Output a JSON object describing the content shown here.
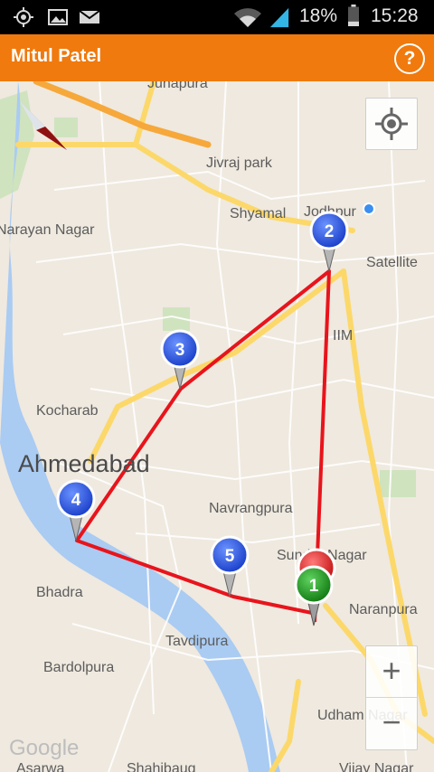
{
  "status_bar": {
    "battery_percent": "18%",
    "time": "15:28",
    "icons": [
      "gps-icon",
      "image-icon",
      "mail-icon",
      "wifi-icon",
      "signal-icon",
      "battery-icon"
    ]
  },
  "app_bar": {
    "title": "Mitul Patel",
    "help_label": "?"
  },
  "map": {
    "labels": {
      "junapura": "Junapura",
      "jivraj_park": "Jivraj park",
      "shyamal": "Shyamal",
      "jodhpur": "Jodhpur",
      "narayan_nagar": "Narayan Nagar",
      "satellite": "Satellite",
      "iim": "IIM",
      "kocharab": "Kocharab",
      "ahmedabad": "Ahmedabad",
      "navrangpura": "Navrangpura",
      "sundar_nagar": "Sundar Nagar",
      "bhadra": "Bhadra",
      "naranpura": "Naranpura",
      "tavdipura": "Tavdipura",
      "bardolpura": "Bardolpura",
      "udham_nagar": "Udham Nagar",
      "vijay_nagar": "Vijay Nagar",
      "shahibaug": "Shahibaug",
      "asarwa": "Asarwa"
    },
    "markers": [
      {
        "label": "1",
        "color": "#1b8a1b"
      },
      {
        "label": "2",
        "color": "#1f4fe0"
      },
      {
        "label": "3",
        "color": "#1f4fe0"
      },
      {
        "label": "4",
        "color": "#1f4fe0"
      },
      {
        "label": "5",
        "color": "#1f4fe0"
      }
    ],
    "route_color": "#e8141c",
    "accent_color": "#f07a0d",
    "controls": {
      "zoom_in": "+",
      "zoom_out": "−",
      "my_location": "my-location-icon",
      "compass": "compass-icon"
    },
    "attribution": "Google"
  }
}
